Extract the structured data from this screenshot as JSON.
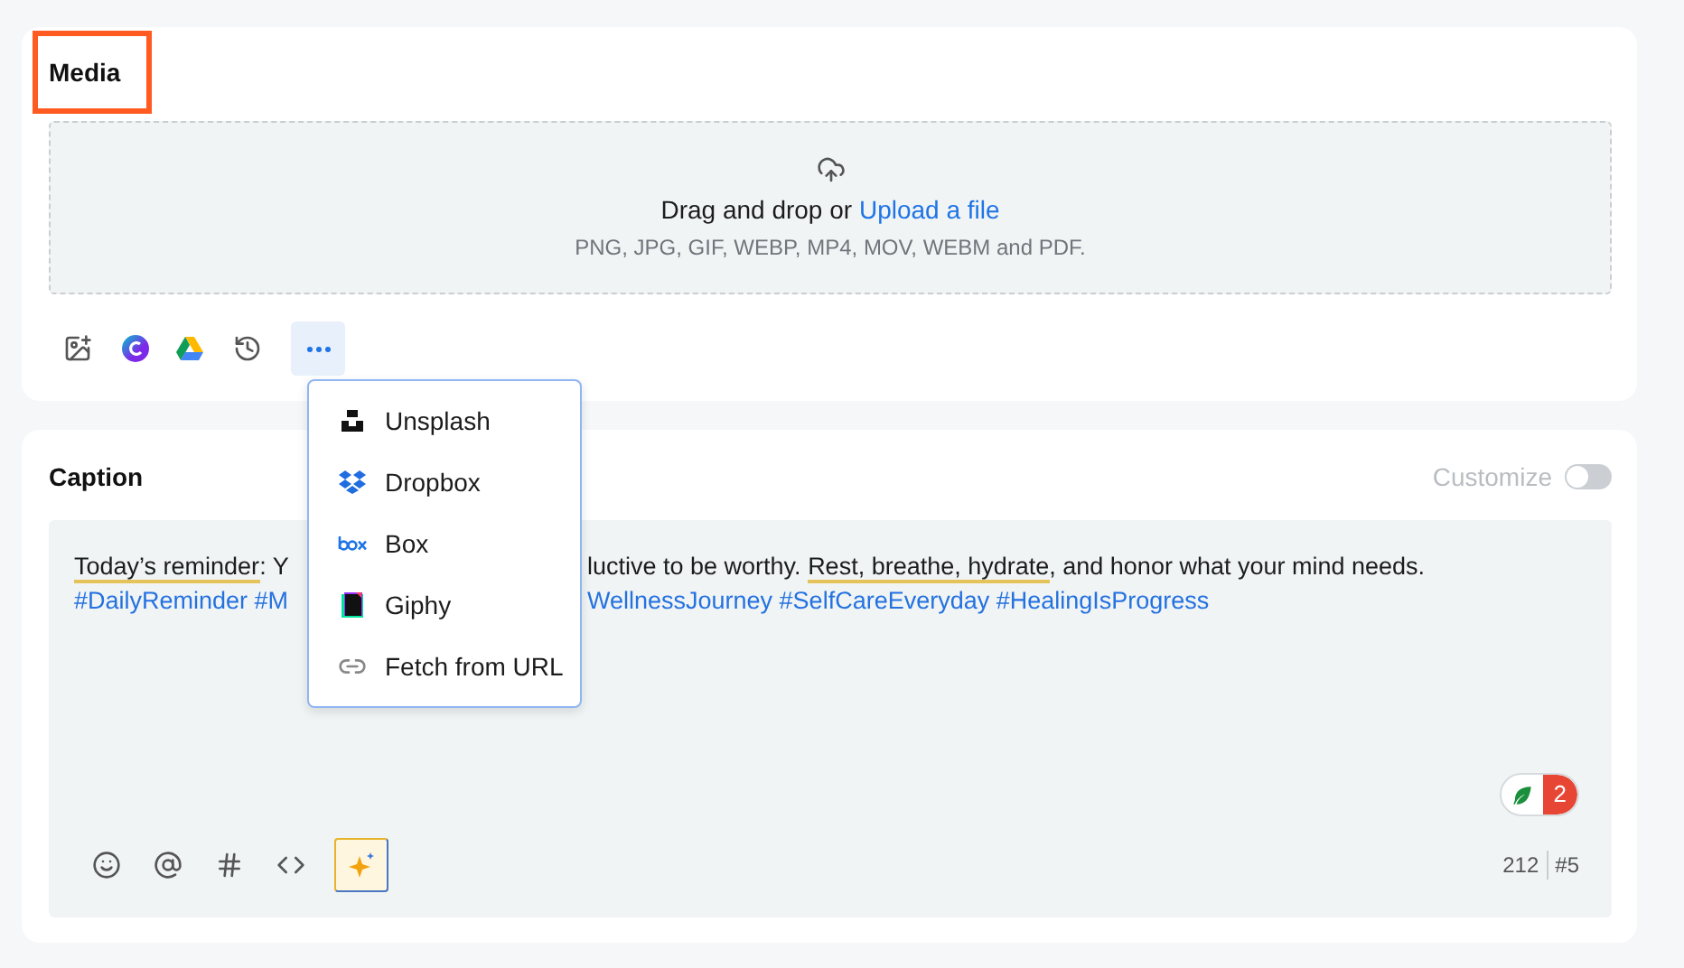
{
  "media": {
    "title": "Media",
    "upload": {
      "prompt": "Drag and drop or",
      "link": "Upload a file",
      "formats": "PNG, JPG, GIF, WEBP, MP4, MOV, WEBM and PDF."
    },
    "more_open": true
  },
  "menu": {
    "items": [
      {
        "kind": "unsplash",
        "label": "Unsplash"
      },
      {
        "kind": "dropbox",
        "label": "Dropbox"
      },
      {
        "kind": "box",
        "label": "Box"
      },
      {
        "kind": "giphy",
        "label": "Giphy"
      },
      {
        "kind": "link",
        "label": "Fetch from URL"
      }
    ]
  },
  "caption": {
    "title": "Caption",
    "customize": {
      "label": "Customize",
      "on": false
    },
    "lines": [
      {
        "kind": "text",
        "left": [
          {
            "text": "Today’s reminder",
            "underlined": true
          },
          {
            "text": ": Y",
            "underlined": false
          }
        ],
        "right": [
          {
            "text": "luctive to be worthy. ",
            "underlined": false
          },
          {
            "text": "Rest, breathe, hydrate",
            "underlined": true
          },
          {
            "text": ", and honor what your mind needs.",
            "underlined": false
          }
        ]
      },
      {
        "kind": "hashtags",
        "left": [
          {
            "text": "#DailyReminder #M",
            "underlined": false
          }
        ],
        "right": [
          {
            "text": "WellnessJourney #SelfCareEveryday #HealingIsProgress",
            "underlined": false
          }
        ]
      }
    ],
    "badge": "2",
    "char_count": "212",
    "post_number": "#5"
  }
}
